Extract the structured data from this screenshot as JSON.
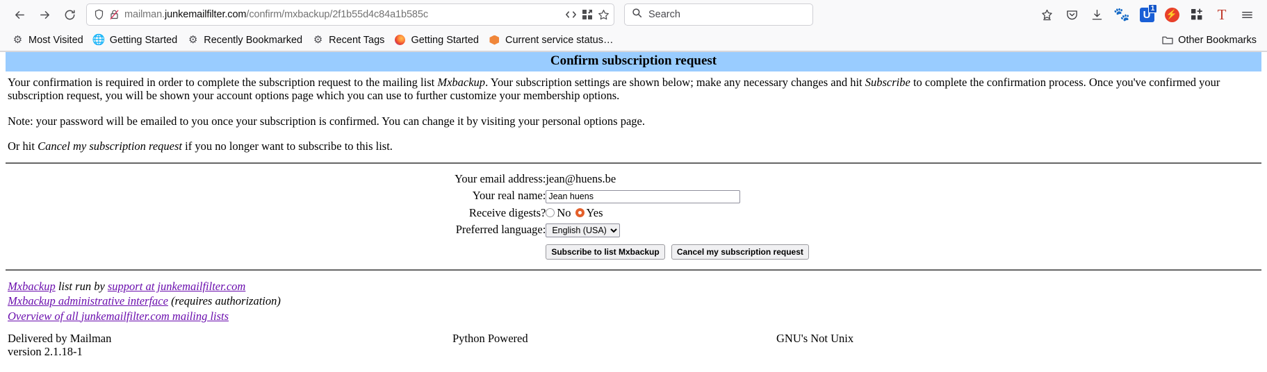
{
  "browser": {
    "nav": {
      "back_icon": "back-arrow-icon",
      "forward_icon": "forward-arrow-icon",
      "reload_icon": "reload-icon"
    },
    "urlbar": {
      "shield_icon": "shield-icon",
      "insecure_icon": "insecure-connection-icon",
      "url_prefix": "mailman.",
      "url_domain": "junkemailfilter.com",
      "url_path": "/confirm/mxbackup/2f1b55d4c84a1b585c",
      "reader_icon": "reader-view-icon",
      "apps_icon": "apps-grid-icon",
      "bookmark_star_icon": "bookmark-star-icon"
    },
    "search": {
      "icon": "search-icon",
      "placeholder": "Search"
    },
    "toolbar_icons": [
      {
        "name": "save-to-pocket-star-icon",
        "label": ""
      },
      {
        "name": "pocket-icon",
        "label": ""
      },
      {
        "name": "downloads-icon",
        "label": ""
      },
      {
        "name": "gnome-extension-icon",
        "label": ""
      },
      {
        "name": "ublock-origin-icon",
        "label": "U",
        "badge": "1"
      },
      {
        "name": "bolt-extension-icon",
        "label": ""
      },
      {
        "name": "grid-add-extension-icon",
        "label": ""
      },
      {
        "name": "text-extension-icon",
        "label": "T"
      },
      {
        "name": "application-menu-icon",
        "label": ""
      }
    ],
    "bookmarks": [
      {
        "icon": "gear-icon",
        "label": "Most Visited"
      },
      {
        "icon": "globe-icon",
        "label": "Getting Started"
      },
      {
        "icon": "gear-icon",
        "label": "Recently Bookmarked"
      },
      {
        "icon": "gear-icon",
        "label": "Recent Tags"
      },
      {
        "icon": "firefox-icon",
        "label": "Getting Started"
      },
      {
        "icon": "package-icon",
        "label": "Current service status…"
      }
    ],
    "other_bookmarks": {
      "icon": "folder-icon",
      "label": "Other Bookmarks"
    }
  },
  "page": {
    "title": "Confirm subscription request",
    "paragraph1_a": "Your confirmation is required in order to complete the subscription request to the mailing list ",
    "paragraph1_list": "Mxbackup",
    "paragraph1_b": ". Your subscription settings are shown below; make any necessary changes and hit ",
    "paragraph1_action": "Subscribe",
    "paragraph1_c": " to complete the confirmation process. Once you've confirmed your subscription request, you will be shown your account options page which you can use to further customize your membership options.",
    "paragraph2": "Note: your password will be emailed to you once your subscription is confirmed. You can change it by visiting your personal options page.",
    "paragraph3_a": "Or hit ",
    "paragraph3_action": "Cancel my subscription request",
    "paragraph3_b": " if you no longer want to subscribe to this list.",
    "form": {
      "email_label": "Your email address:",
      "email_value": "jean@huens.be",
      "realname_label": "Your real name:",
      "realname_value": "Jean huens",
      "digests_label": "Receive digests?",
      "digest_no": "No",
      "digest_yes": "Yes",
      "digest_selected": "Yes",
      "language_label": "Preferred language:",
      "language_value": "English (USA)",
      "language_options": [
        "English (USA)"
      ],
      "subscribe_button": "Subscribe to list Mxbackup",
      "cancel_button": "Cancel my subscription request",
      "accent_color": "#e4602b"
    },
    "footer": {
      "line1_link1": "Mxbackup",
      "line1_mid": " list run by ",
      "line1_link2": "support at junkemailfilter.com",
      "line2_link": "Mxbackup administrative interface",
      "line2_tail": " (requires authorization)",
      "line3_link": "Overview of all junkemailfilter.com mailing lists",
      "delivered_by": "Delivered by Mailman",
      "version": "version 2.1.18-1",
      "python_powered": "Python Powered",
      "gnu": "GNU's Not Unix",
      "link_color": "#6a0dad"
    },
    "header_bg": "#99ccff"
  }
}
